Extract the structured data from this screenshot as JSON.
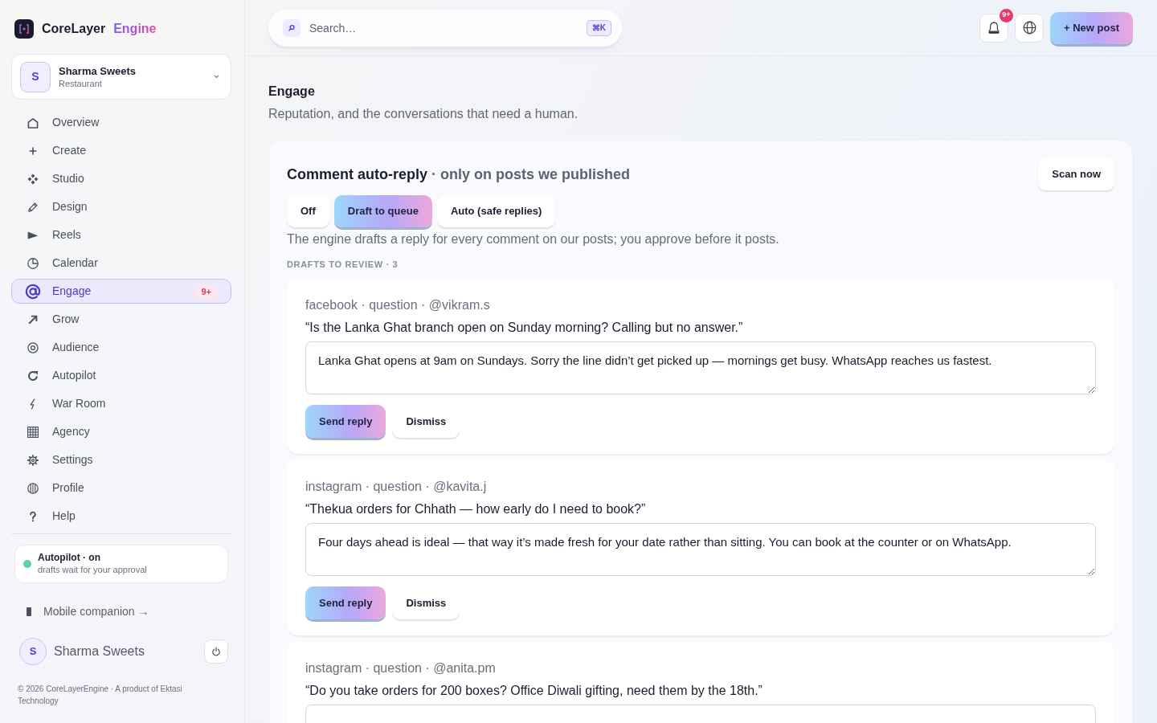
{
  "brand": {
    "name": "CoreLayer",
    "accent": "Engine"
  },
  "workspace": {
    "avatar": "S",
    "name": "Sharma Sweets",
    "type": "Restaurant"
  },
  "nav": [
    {
      "label": "Overview",
      "selected": false
    },
    {
      "label": "Create",
      "selected": false
    },
    {
      "label": "Studio",
      "selected": false
    },
    {
      "label": "Design",
      "selected": false
    },
    {
      "label": "Reels",
      "selected": false
    },
    {
      "label": "Calendar",
      "selected": false
    },
    {
      "label": "Engage",
      "selected": true,
      "badge": "9+"
    },
    {
      "label": "Grow",
      "selected": false
    },
    {
      "label": "Audience",
      "selected": false
    },
    {
      "label": "Autopilot",
      "selected": false
    },
    {
      "label": "War Room",
      "selected": false
    },
    {
      "label": "Agency",
      "selected": false
    },
    {
      "label": "Settings",
      "selected": false
    },
    {
      "label": "Profile",
      "selected": false
    },
    {
      "label": "Help",
      "selected": false
    }
  ],
  "autopilot": {
    "title": "Autopilot · on",
    "on": true,
    "note": "drafts wait for your approval"
  },
  "mobile_link": "Mobile companion →",
  "user": {
    "avatar": "S",
    "name": "Sharma Sweets"
  },
  "footer": "© 2026 CoreLayerEngine · A product of Ektasi Technology",
  "search": {
    "placeholder": "Search…",
    "shortcut": "⌘K"
  },
  "notifications": {
    "badge": "9+"
  },
  "new_post_button": "+ New post",
  "page": {
    "title": "Engage",
    "subtitle": "Reputation, and the conversations that need a human."
  },
  "auto_reply": {
    "title": "Comment auto-reply",
    "qualifier": "· only on posts we published",
    "scan_button": "Scan now",
    "modes": [
      {
        "label": "Off",
        "selected": false
      },
      {
        "label": "Draft to queue",
        "selected": true
      },
      {
        "label": "Auto (safe replies)",
        "selected": false
      }
    ],
    "description": "The engine drafts a reply for every comment on our posts; you approve before it posts.",
    "drafts_heading": "DRAFTS TO REVIEW · 3",
    "drafts": [
      {
        "meta": "facebook · question · @vikram.s",
        "comment": "“Is the Lanka Ghat branch open on Sunday morning? Calling but no answer.”",
        "reply": "Lanka Ghat opens at 9am on Sundays. Sorry the line didn’t get picked up — mornings get busy. WhatsApp reaches us fastest.",
        "send_label": "Send reply",
        "dismiss_label": "Dismiss"
      },
      {
        "meta": "instagram · question · @kavita.j",
        "comment": "“Thekua orders for Chhath — how early do I need to book?”",
        "reply": "Four days ahead is ideal — that way it’s made fresh for your date rather than sitting. You can book at the counter or on WhatsApp.",
        "send_label": "Send reply",
        "dismiss_label": "Dismiss"
      },
      {
        "meta": "instagram · question · @anita.pm",
        "comment": "“Do you take orders for 200 boxes? Office Diwali gifting, need them by the 18th.”"
      }
    ]
  }
}
